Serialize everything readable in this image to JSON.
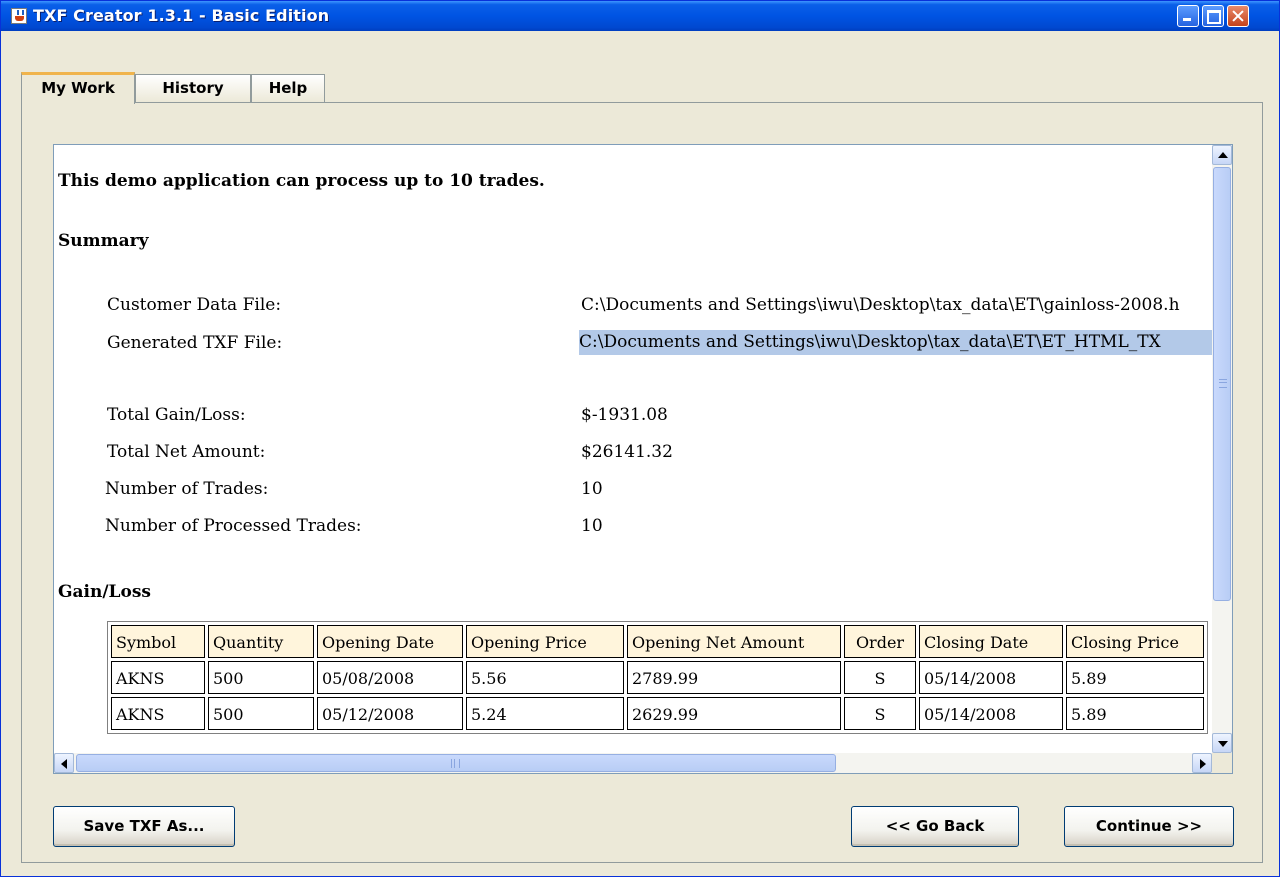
{
  "window": {
    "title": "TXF Creator 1.3.1 - Basic Edition",
    "controls": [
      "minimize",
      "maximize",
      "close"
    ]
  },
  "tabs": [
    {
      "label": "My Work",
      "active": true
    },
    {
      "label": "History",
      "active": false
    },
    {
      "label": "Help",
      "active": false
    }
  ],
  "report": {
    "notice": "This demo application can process up to 10 trades.",
    "summary_heading": "Summary",
    "summary": {
      "customer_file_label": "Customer Data File:",
      "customer_file_value": "C:\\Documents and Settings\\iwu\\Desktop\\tax_data\\ET\\gainloss-2008.h",
      "txf_file_label": "Generated TXF File:",
      "txf_file_value": "C:\\Documents and Settings\\iwu\\Desktop\\tax_data\\ET\\ET_HTML_TX",
      "gain_loss_label": "Total Gain/Loss:",
      "gain_loss_value": "$-1931.08",
      "net_amount_label": "Total Net Amount:",
      "net_amount_value": "$26141.32",
      "trades_label": "Number of Trades:",
      "trades_value": "10",
      "processed_label": "Number of Processed Trades:",
      "processed_value": "10"
    },
    "gainloss_heading": "Gain/Loss",
    "table": {
      "headers": [
        "Symbol",
        "Quantity",
        "Opening Date",
        "Opening Price",
        "Opening Net Amount",
        "Order",
        "Closing Date",
        "Closing Price"
      ],
      "rows": [
        [
          "AKNS",
          "500",
          "05/08/2008",
          "5.56",
          "2789.99",
          "S",
          "05/14/2008",
          "5.89"
        ],
        [
          "AKNS",
          "500",
          "05/12/2008",
          "5.24",
          "2629.99",
          "S",
          "05/14/2008",
          "5.89"
        ]
      ]
    }
  },
  "buttons": {
    "save": "Save TXF As...",
    "back": "<<  Go Back",
    "continue": "Continue  >>"
  },
  "colors": {
    "titlebar": "#0054e3",
    "highlight": "#b3c9e8",
    "table_header": "#fff5dc",
    "active_tab_accent": "#f0b44c"
  }
}
